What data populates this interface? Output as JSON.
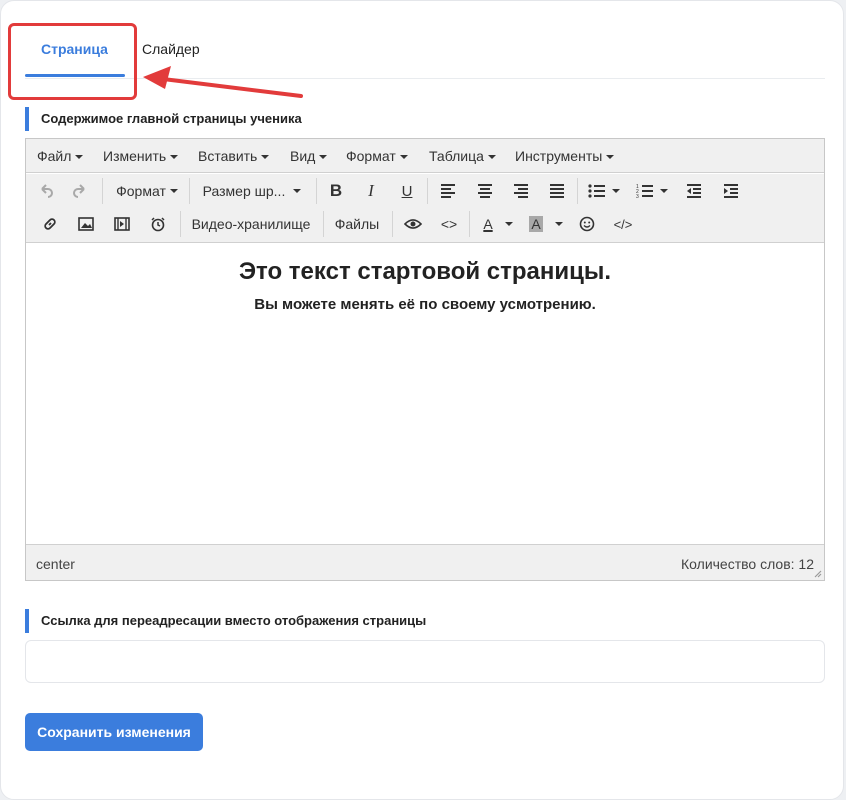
{
  "tabs": [
    {
      "label": "Страница",
      "active": true
    },
    {
      "label": "Слайдер",
      "active": false
    }
  ],
  "sections": {
    "content_label": "Содержимое главной страницы ученика",
    "redirect_label": "Ссылка для переадресации вместо отображения страницы"
  },
  "editor": {
    "menu": [
      "Файл",
      "Изменить",
      "Вставить",
      "Вид",
      "Формат",
      "Таблица",
      "Инструменты"
    ],
    "toolbar": {
      "format_label": "Формат",
      "font_size_label": "Размер шр...",
      "video_storage_label": "Видео-хранилище",
      "files_label": "Файлы"
    },
    "content": {
      "heading": "Это текст стартовой страницы.",
      "paragraph": "Вы можете менять её по своему усмотрению."
    },
    "status": {
      "path": "center",
      "word_count": "Количество слов: 12"
    }
  },
  "redirect_input": {
    "value": "",
    "placeholder": ""
  },
  "save_button": "Сохранить изменения",
  "colors": {
    "accent": "#3b7ddd",
    "highlight": "#e23b3b"
  }
}
